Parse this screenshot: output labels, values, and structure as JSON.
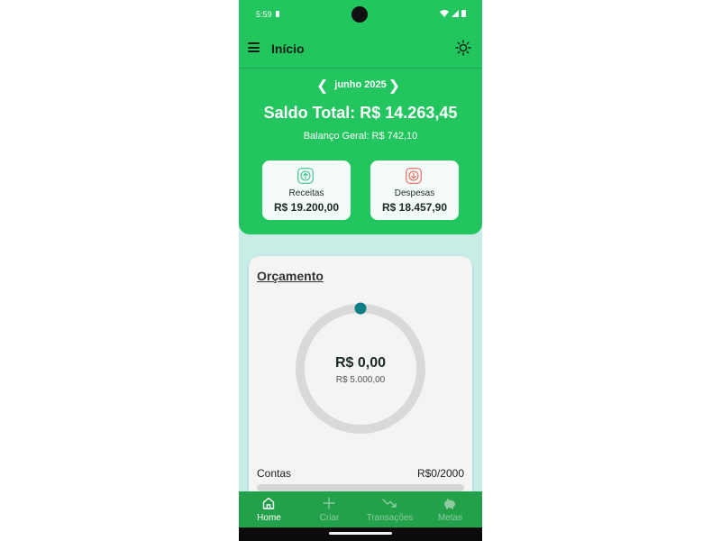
{
  "status": {
    "time": "5:59"
  },
  "app": {
    "title": "Início"
  },
  "header": {
    "month": "junho 2025",
    "saldo_total": "Saldo Total: R$ 14.263,45",
    "balanco_geral": "Balanço Geral: R$ 742,10"
  },
  "cards": {
    "receitas": {
      "label": "Receitas",
      "value": "R$ 19.200,00",
      "icon": "arrow-up-icon",
      "color": "#3ec28a"
    },
    "despesas": {
      "label": "Despesas",
      "value": "R$ 18.457,90",
      "icon": "arrow-down-icon",
      "color": "#e06a5a"
    }
  },
  "budget": {
    "title": "Orçamento",
    "spent": "R$ 0,00",
    "total": "R$ 5.000,00",
    "progress": 0,
    "contas_label": "Contas",
    "contas_value": "R$0/2000",
    "contas_progress": 0,
    "track_color": "#d9d9d9",
    "knob_color": "#0e7f86"
  },
  "nav": {
    "items": [
      {
        "label": "Home",
        "icon": "home-icon",
        "active": true
      },
      {
        "label": "Criar",
        "icon": "plus-icon",
        "active": false
      },
      {
        "label": "Transações",
        "icon": "trending-down-icon",
        "active": false
      },
      {
        "label": "Metas",
        "icon": "piggy-bank-icon",
        "active": false
      }
    ]
  },
  "colors": {
    "primary": "#22c55e",
    "nav": "#22a04a",
    "background": "#c9ece6"
  }
}
